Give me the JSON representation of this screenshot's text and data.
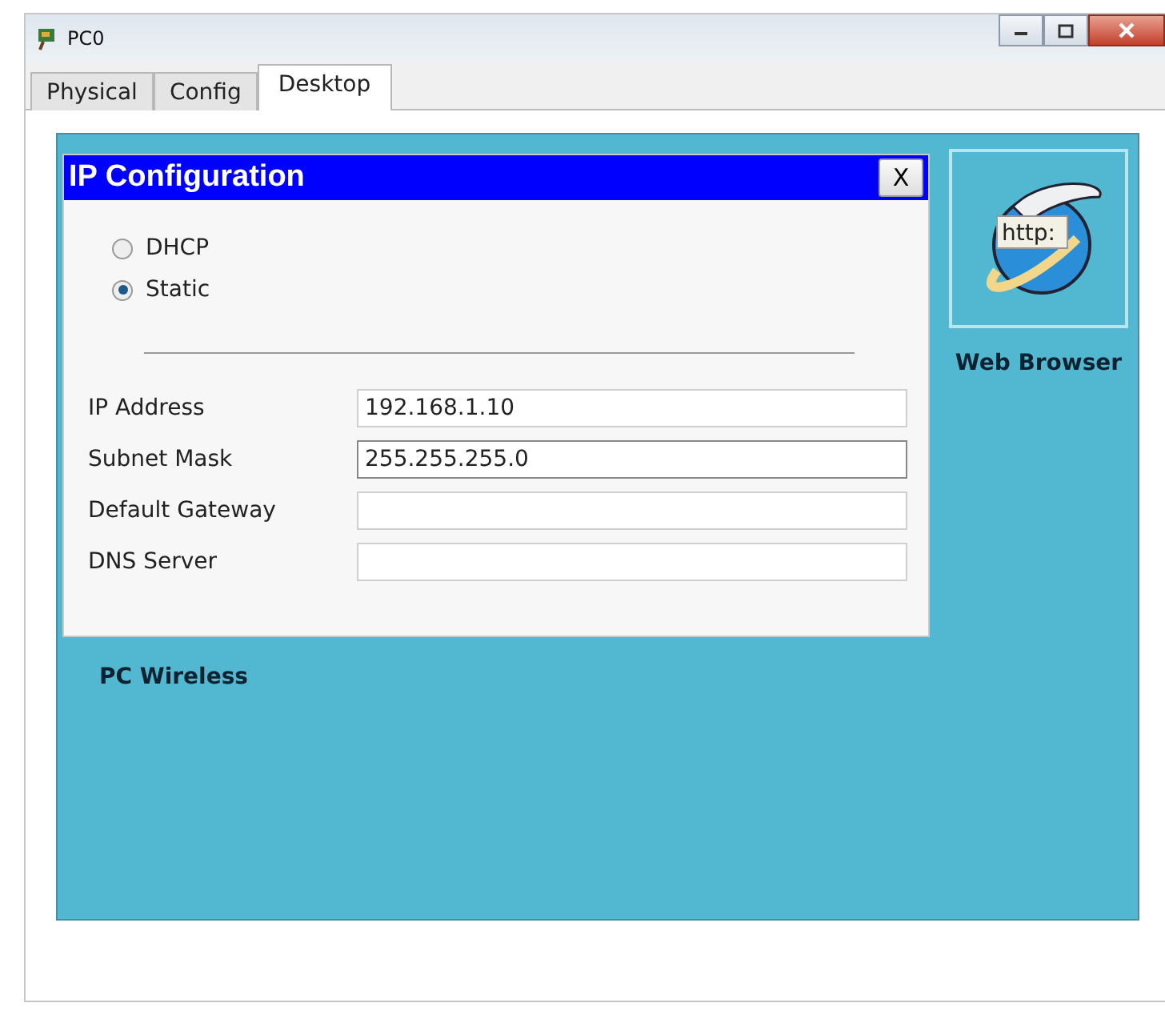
{
  "window": {
    "title": "PC0"
  },
  "tabs": [
    {
      "label": "Physical",
      "selected": false
    },
    {
      "label": "Config",
      "selected": false
    },
    {
      "label": "Desktop",
      "selected": true
    }
  ],
  "desktop": {
    "apps": [
      {
        "kind": "browser",
        "icon_text": "http:",
        "label": "Web Browser"
      },
      {
        "kind": "hidden",
        "label": "PC Wireless"
      }
    ]
  },
  "dialog": {
    "title": "IP Configuration",
    "close": "X",
    "modes": [
      {
        "label": "DHCP",
        "selected": false
      },
      {
        "label": "Static",
        "selected": true
      }
    ],
    "fields": [
      {
        "label": "IP Address",
        "value": "192.168.1.10",
        "focused": false
      },
      {
        "label": "Subnet Mask",
        "value": "255.255.255.0",
        "focused": true
      },
      {
        "label": "Default Gateway",
        "focused": false
      },
      {
        "label": "DNS Server",
        "focused": false
      }
    ]
  }
}
